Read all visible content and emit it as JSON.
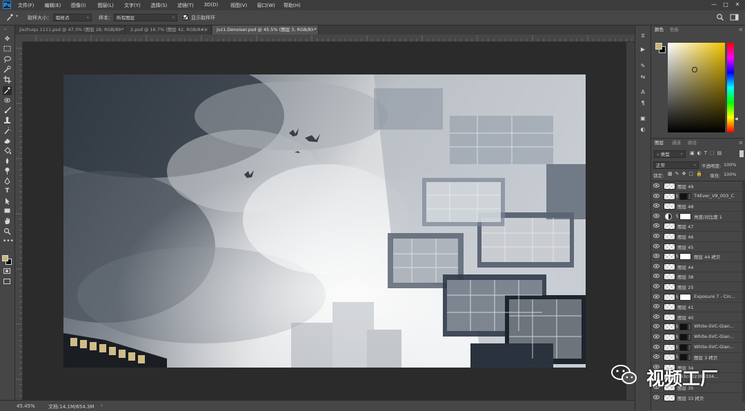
{
  "app": {
    "logo": "Ps"
  },
  "menu": [
    "文件(F)",
    "编辑(E)",
    "图像(I)",
    "图层(L)",
    "文字(Y)",
    "选择(S)",
    "滤镜(T)",
    "3D(D)",
    "视图(V)",
    "窗口(W)",
    "帮助(H)"
  ],
  "window_controls": {
    "minimize": "—",
    "maximize": "□",
    "close": "✕"
  },
  "options": {
    "sample_size_label": "取样大小：",
    "sample_size_value": "取样点",
    "sample_label": "样本：",
    "sample_value": "所有图层",
    "show_ring_label": "显示取样环",
    "show_ring_checked": true
  },
  "tabs": [
    {
      "label": "jiezhuqu 1111.psd @ 47.3% (图层 28, RGB/8) *",
      "active": false
    },
    {
      "label": "2.psd @ 16.7% (图层 42, RGB/8#)",
      "active": false
    },
    {
      "label": "jvz1.Denoiser.psd @ 45.5% (图层 3, RGB/8) *",
      "active": true
    }
  ],
  "status": {
    "zoom": "45.45%",
    "doc": "文档:14.1M/654.3M"
  },
  "color_panel": {
    "tabs": [
      "颜色",
      "色板"
    ],
    "foreground": "#c8b47a",
    "background": "#000000",
    "hue": "#f0c400"
  },
  "layers_panel": {
    "tabs": [
      "图层",
      "通道",
      "路径"
    ],
    "filter_label": "类型",
    "blend_mode": "正常",
    "opacity_label": "不透明度:",
    "opacity_value": "100%",
    "lock_label": "锁定:",
    "fill_label": "填充:",
    "fill_value": "100%",
    "layers": [
      {
        "name": "图层 49",
        "mask": "none",
        "link": false
      },
      {
        "name": "T4Ever_V9_003_C",
        "mask": "dark",
        "link": true
      },
      {
        "name": "图层 48",
        "mask": "none",
        "link": false
      },
      {
        "name": "亮度/对比度 1",
        "mask": "white",
        "link": true,
        "adjust": true
      },
      {
        "name": "图层 47",
        "mask": "none",
        "link": false
      },
      {
        "name": "图层 46",
        "mask": "none",
        "link": false
      },
      {
        "name": "图层 45",
        "mask": "none",
        "link": false
      },
      {
        "name": "图层 44 拷贝",
        "mask": "white",
        "link": true
      },
      {
        "name": "图层 44",
        "mask": "none",
        "link": false
      },
      {
        "name": "图层 38",
        "mask": "none",
        "link": false
      },
      {
        "name": "图层 25",
        "mask": "none",
        "link": false
      },
      {
        "name": "Exposure 7 - Cin...",
        "mask": "white",
        "link": true
      },
      {
        "name": "图层 41",
        "mask": "none",
        "link": false
      },
      {
        "name": "图层 40",
        "mask": "none",
        "link": false
      },
      {
        "name": "White-SVC-Gian...",
        "mask": "dark",
        "link": true
      },
      {
        "name": "White-SVC-Gian...",
        "mask": "dark",
        "link": true
      },
      {
        "name": "White-SVC-Gian...",
        "mask": "dark",
        "link": true
      },
      {
        "name": "图层 3 拷贝",
        "mask": "dark",
        "link": true
      },
      {
        "name": "图层 34",
        "mask": "none",
        "link": false
      },
      {
        "name": "643c0d2386334...",
        "mask": "none",
        "link": false
      },
      {
        "name": "图层 35",
        "mask": "none",
        "link": false
      },
      {
        "name": "图层 33 拷贝",
        "mask": "none",
        "link": false
      }
    ]
  },
  "watermark": {
    "text": "视频工厂"
  }
}
